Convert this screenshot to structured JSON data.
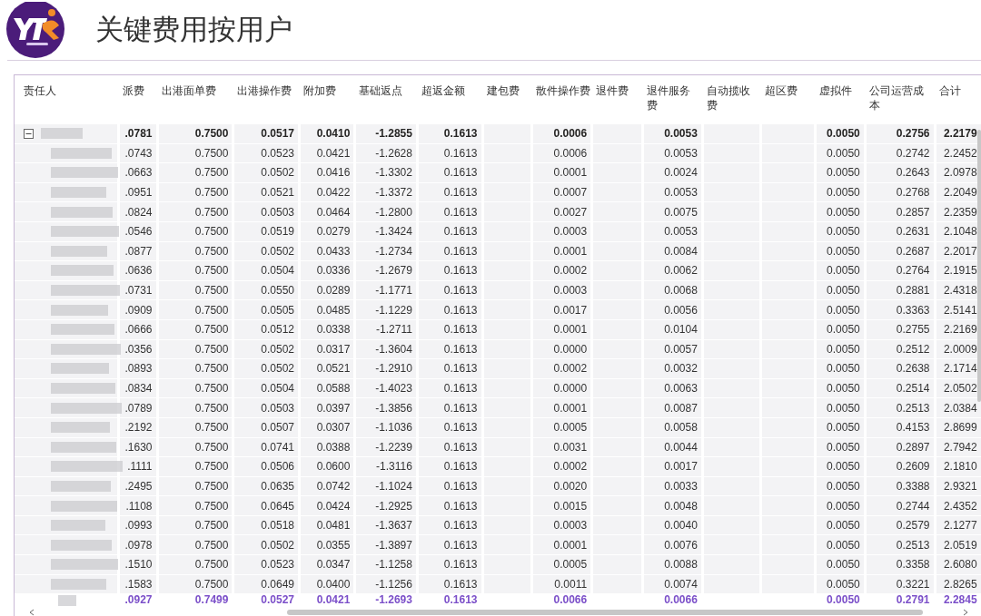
{
  "header": {
    "title": "关键费用按用户"
  },
  "table": {
    "columns": [
      "责任人",
      "派费",
      "出港面单费",
      "出港操作费",
      "附加费",
      "基础返点",
      "超返金额",
      "建包费",
      "散件操作费",
      "退件费",
      "退件服务费",
      "自动揽收费",
      "超区费",
      "虚拟件",
      "公司运营成本",
      "合计"
    ],
    "rows": [
      {
        "kind": "group",
        "expanded": true,
        "cells": [
          null,
          ".0781",
          "0.7500",
          "0.0517",
          "0.0410",
          "-1.2855",
          "0.1613",
          null,
          "0.0006",
          null,
          "0.0053",
          null,
          null,
          "0.0050",
          "0.2756",
          "2.2179"
        ]
      },
      {
        "kind": "row",
        "cells": [
          null,
          ".0743",
          "0.7500",
          "0.0523",
          "0.0421",
          "-1.2628",
          "0.1613",
          null,
          "0.0006",
          null,
          "0.0053",
          null,
          null,
          "0.0050",
          "0.2742",
          "2.2452"
        ]
      },
      {
        "kind": "row",
        "cells": [
          null,
          ".0663",
          "0.7500",
          "0.0502",
          "0.0416",
          "-1.3302",
          "0.1613",
          null,
          "0.0001",
          null,
          "0.0024",
          null,
          null,
          "0.0050",
          "0.2643",
          "2.0978"
        ]
      },
      {
        "kind": "row",
        "cells": [
          null,
          ".0951",
          "0.7500",
          "0.0521",
          "0.0422",
          "-1.3372",
          "0.1613",
          null,
          "0.0007",
          null,
          "0.0053",
          null,
          null,
          "0.0050",
          "0.2768",
          "2.2049"
        ]
      },
      {
        "kind": "row",
        "cells": [
          null,
          ".0824",
          "0.7500",
          "0.0503",
          "0.0464",
          "-1.2800",
          "0.1613",
          null,
          "0.0027",
          null,
          "0.0075",
          null,
          null,
          "0.0050",
          "0.2857",
          "2.2359"
        ]
      },
      {
        "kind": "row",
        "cells": [
          null,
          ".0546",
          "0.7500",
          "0.0519",
          "0.0279",
          "-1.3424",
          "0.1613",
          null,
          "0.0003",
          null,
          "0.0053",
          null,
          null,
          "0.0050",
          "0.2631",
          "2.1048"
        ]
      },
      {
        "kind": "row",
        "cells": [
          null,
          ".0877",
          "0.7500",
          "0.0502",
          "0.0433",
          "-1.2734",
          "0.1613",
          null,
          "0.0001",
          null,
          "0.0084",
          null,
          null,
          "0.0050",
          "0.2687",
          "2.2017"
        ]
      },
      {
        "kind": "row",
        "cells": [
          null,
          ".0636",
          "0.7500",
          "0.0504",
          "0.0336",
          "-1.2679",
          "0.1613",
          null,
          "0.0002",
          null,
          "0.0062",
          null,
          null,
          "0.0050",
          "0.2764",
          "2.1915"
        ]
      },
      {
        "kind": "row",
        "cells": [
          null,
          ".0731",
          "0.7500",
          "0.0550",
          "0.0289",
          "-1.1771",
          "0.1613",
          null,
          "0.0003",
          null,
          "0.0068",
          null,
          null,
          "0.0050",
          "0.2881",
          "2.4318"
        ]
      },
      {
        "kind": "row",
        "cells": [
          null,
          ".0909",
          "0.7500",
          "0.0505",
          "0.0485",
          "-1.1229",
          "0.1613",
          null,
          "0.0017",
          null,
          "0.0056",
          null,
          null,
          "0.0050",
          "0.3363",
          "2.5141"
        ]
      },
      {
        "kind": "row",
        "cells": [
          null,
          ".0666",
          "0.7500",
          "0.0512",
          "0.0338",
          "-1.2711",
          "0.1613",
          null,
          "0.0001",
          null,
          "0.0104",
          null,
          null,
          "0.0050",
          "0.2755",
          "2.2169"
        ]
      },
      {
        "kind": "row",
        "cells": [
          null,
          ".0356",
          "0.7500",
          "0.0502",
          "0.0317",
          "-1.3604",
          "0.1613",
          null,
          "0.0000",
          null,
          "0.0057",
          null,
          null,
          "0.0050",
          "0.2512",
          "2.0009"
        ]
      },
      {
        "kind": "row",
        "cells": [
          null,
          ".0893",
          "0.7500",
          "0.0502",
          "0.0521",
          "-1.2910",
          "0.1613",
          null,
          "0.0002",
          null,
          "0.0032",
          null,
          null,
          "0.0050",
          "0.2638",
          "2.1714"
        ]
      },
      {
        "kind": "row",
        "cells": [
          null,
          ".0834",
          "0.7500",
          "0.0504",
          "0.0588",
          "-1.4023",
          "0.1613",
          null,
          "0.0000",
          null,
          "0.0063",
          null,
          null,
          "0.0050",
          "0.2514",
          "2.0502"
        ]
      },
      {
        "kind": "row",
        "cells": [
          null,
          ".0789",
          "0.7500",
          "0.0503",
          "0.0397",
          "-1.3856",
          "0.1613",
          null,
          "0.0001",
          null,
          "0.0087",
          null,
          null,
          "0.0050",
          "0.2513",
          "2.0384"
        ]
      },
      {
        "kind": "row",
        "cells": [
          null,
          ".2192",
          "0.7500",
          "0.0507",
          "0.0307",
          "-1.1036",
          "0.1613",
          null,
          "0.0005",
          null,
          "0.0058",
          null,
          null,
          "0.0050",
          "0.4153",
          "2.8699"
        ]
      },
      {
        "kind": "row",
        "cells": [
          null,
          ".1630",
          "0.7500",
          "0.0741",
          "0.0388",
          "-1.2239",
          "0.1613",
          null,
          "0.0031",
          null,
          "0.0044",
          null,
          null,
          "0.0050",
          "0.2897",
          "2.7942"
        ]
      },
      {
        "kind": "row",
        "cells": [
          null,
          ".1111",
          "0.7500",
          "0.0506",
          "0.0600",
          "-1.3116",
          "0.1613",
          null,
          "0.0002",
          null,
          "0.0017",
          null,
          null,
          "0.0050",
          "0.2609",
          "2.1810"
        ]
      },
      {
        "kind": "row",
        "cells": [
          null,
          ".2495",
          "0.7500",
          "0.0635",
          "0.0742",
          "-1.1024",
          "0.1613",
          null,
          "0.0020",
          null,
          "0.0033",
          null,
          null,
          "0.0050",
          "0.3388",
          "2.9321"
        ]
      },
      {
        "kind": "row",
        "cells": [
          null,
          ".1108",
          "0.7500",
          "0.0645",
          "0.0424",
          "-1.2925",
          "0.1613",
          null,
          "0.0015",
          null,
          "0.0048",
          null,
          null,
          "0.0050",
          "0.2744",
          "2.4352"
        ]
      },
      {
        "kind": "row",
        "cells": [
          null,
          ".0993",
          "0.7500",
          "0.0518",
          "0.0481",
          "-1.3637",
          "0.1613",
          null,
          "0.0003",
          null,
          "0.0040",
          null,
          null,
          "0.0050",
          "0.2579",
          "2.1277"
        ]
      },
      {
        "kind": "row",
        "cells": [
          null,
          ".0978",
          "0.7500",
          "0.0502",
          "0.0355",
          "-1.3897",
          "0.1613",
          null,
          "0.0001",
          null,
          "0.0076",
          null,
          null,
          "0.0050",
          "0.2513",
          "2.0519"
        ]
      },
      {
        "kind": "row",
        "cells": [
          null,
          ".1510",
          "0.7500",
          "0.0523",
          "0.0347",
          "-1.1258",
          "0.1613",
          null,
          "0.0005",
          null,
          "0.0088",
          null,
          null,
          "0.0050",
          "0.3358",
          "2.6080"
        ]
      },
      {
        "kind": "row",
        "cells": [
          null,
          ".1583",
          "0.7500",
          "0.0649",
          "0.0400",
          "-1.1256",
          "0.1613",
          null,
          "0.0011",
          null,
          "0.0074",
          null,
          null,
          "0.0050",
          "0.3221",
          "2.8265"
        ]
      },
      {
        "kind": "total",
        "cells": [
          null,
          ".0927",
          "0.7499",
          "0.0527",
          "0.0421",
          "-1.2693",
          "0.1613",
          null,
          "0.0066",
          null,
          "0.0066",
          null,
          null,
          "0.0050",
          "0.2791",
          "2.2845"
        ]
      }
    ]
  }
}
